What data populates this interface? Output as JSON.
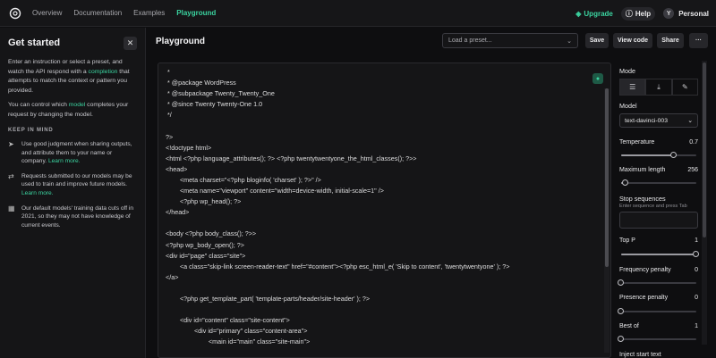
{
  "nav": {
    "links": [
      "Overview",
      "Documentation",
      "Examples",
      "Playground"
    ],
    "upgrade": "Upgrade",
    "help": "Help",
    "avatar_initial": "Y",
    "account": "Personal"
  },
  "sidebar": {
    "title": "Get started",
    "intro_before": "Enter an instruction or select a preset, and watch the API respond with a ",
    "intro_link": "completion",
    "intro_after": " that attempts to match the context or pattern you provided.",
    "control_before": "You can control which ",
    "control_link": "model",
    "control_after": " completes your request by changing the model.",
    "keep_in_mind": "KEEP IN MIND",
    "items": [
      {
        "icon": "send-icon",
        "text": "Use good judgment when sharing outputs, and attribute them to your name or company. ",
        "link": "Learn more."
      },
      {
        "icon": "arrow-swap-icon",
        "text": "Requests submitted to our models may be used to train and improve future models. ",
        "link": "Learn more."
      },
      {
        "icon": "calendar-icon",
        "text": "Our default models' training data cuts off in 2021, so they may not have knowledge of current events.",
        "link": ""
      }
    ]
  },
  "header": {
    "title": "Playground",
    "preset_placeholder": "Load a preset...",
    "save": "Save",
    "view_code": "View code",
    "share": "Share",
    "more": "···"
  },
  "editor": {
    "lines": [
      " *",
      " * @package WordPress",
      " * @subpackage Twenty_Twenty_One",
      " * @since Twenty Twenty-One 1.0",
      " */",
      "",
      "?>",
      "<!doctype html>",
      "<html <?php language_attributes(); ?> <?php twentytwentyone_the_html_classes(); ?>>",
      "<head>",
      "        <meta charset=\"<?php bloginfo( 'charset' ); ?>\" />",
      "        <meta name=\"viewport\" content=\"width=device-width, initial-scale=1\" />",
      "        <?php wp_head(); ?>",
      "</head>",
      "",
      "<body <?php body_class(); ?>>",
      "<?php wp_body_open(); ?>",
      "<div id=\"page\" class=\"site\">",
      "        <a class=\"skip-link screen-reader-text\" href=\"#content\"><?php esc_html_e( 'Skip to content', 'twentytwentyone' ); ?>",
      "</a>",
      "",
      "        <?php get_template_part( 'template-parts/header/site-header' ); ?>",
      "",
      "        <div id=\"content\" class=\"site-content\">",
      "                <div id=\"primary\" class=\"content-area\">",
      "                        <main id=\"main\" class=\"site-main\">"
    ]
  },
  "settings": {
    "mode_label": "Mode",
    "mode_icons": [
      "complete-mode-icon",
      "insert-mode-icon",
      "edit-mode-icon"
    ],
    "model_label": "Model",
    "model_value": "text-davinci-003",
    "temperature": {
      "label": "Temperature",
      "value": "0.7",
      "fraction": 0.7
    },
    "max_length": {
      "label": "Maximum length",
      "value": "256",
      "fraction": 0.06
    },
    "stop_sequences": {
      "label": "Stop sequences",
      "hint": "Enter sequence and press Tab"
    },
    "top_p": {
      "label": "Top P",
      "value": "1",
      "fraction": 1.0
    },
    "frequency_penalty": {
      "label": "Frequency penalty",
      "value": "0",
      "fraction": 0.0
    },
    "presence_penalty": {
      "label": "Presence penalty",
      "value": "0",
      "fraction": 0.0
    },
    "best_of": {
      "label": "Best of",
      "value": "1",
      "fraction": 0.0
    },
    "inject_start": {
      "label": "Inject start text"
    }
  },
  "colors": {
    "accent": "#3bd4a0",
    "background": "#0e0e10",
    "panel": "#151517"
  }
}
